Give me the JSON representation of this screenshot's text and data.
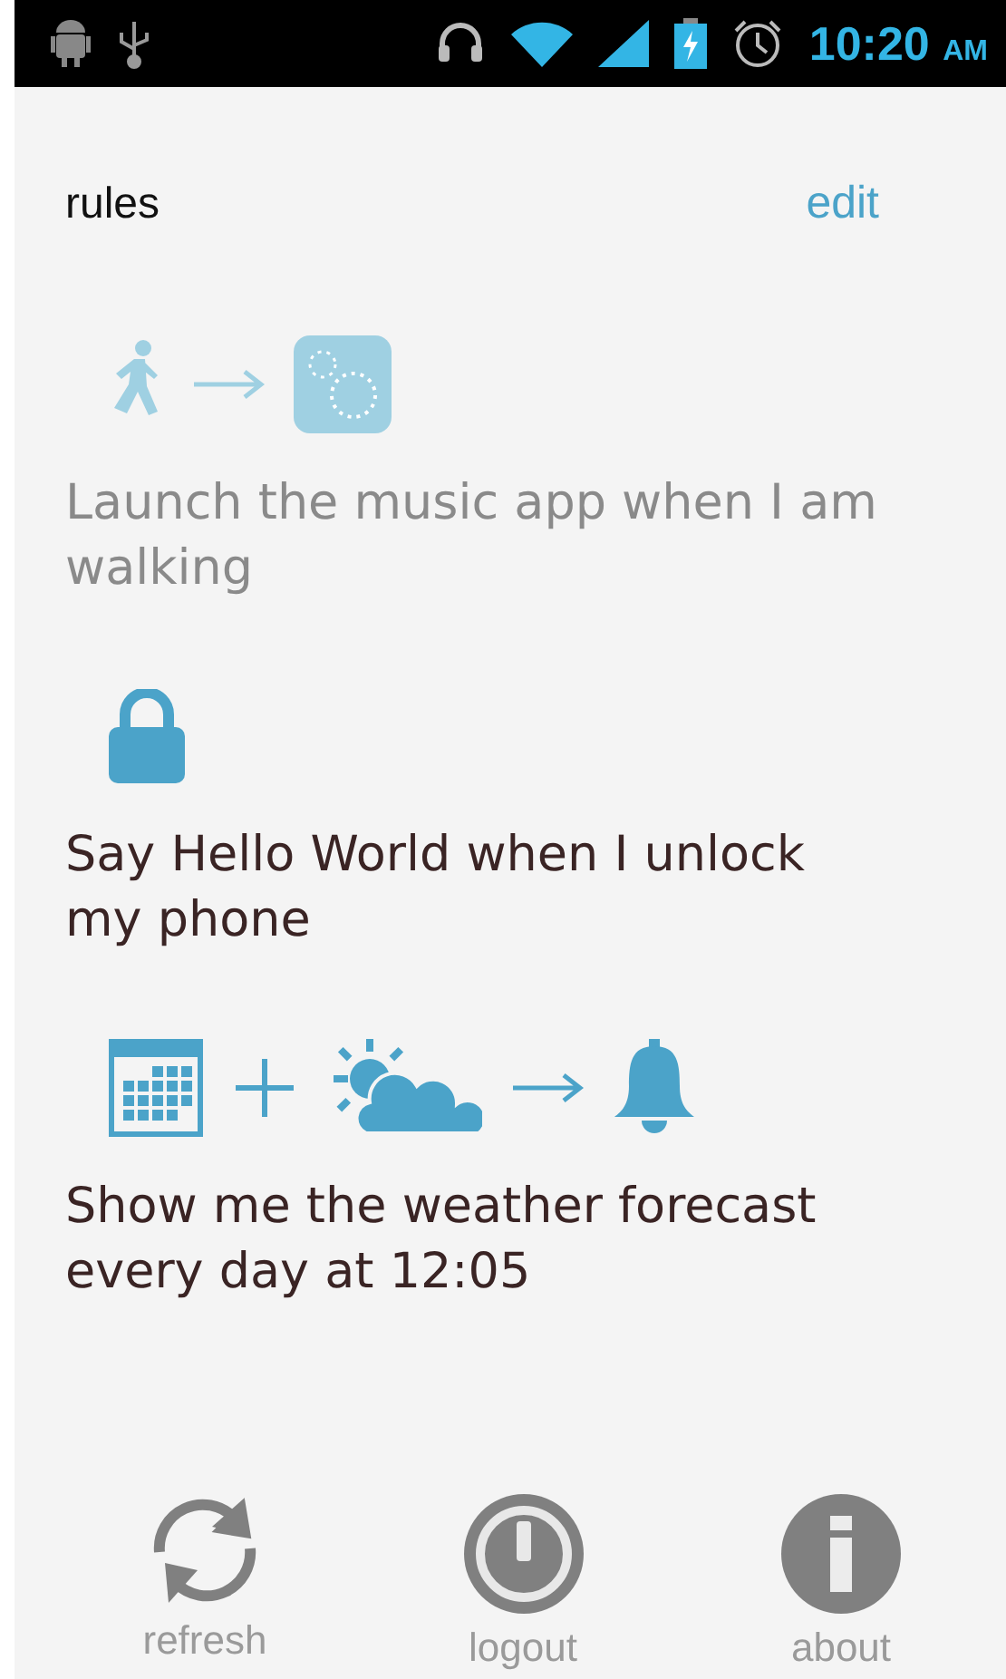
{
  "status_bar": {
    "time": "10:20",
    "meridiem": "AM"
  },
  "header": {
    "title": "rules",
    "action": "edit"
  },
  "rules": [
    {
      "enabled": false,
      "icons": [
        {
          "kind": "walk"
        },
        {
          "kind": "arrow"
        },
        {
          "kind": "app"
        }
      ],
      "text": "Launch the music app when I am walking"
    },
    {
      "enabled": true,
      "icons": [
        {
          "kind": "lock"
        }
      ],
      "text": "Say Hello World when I unlock my phone"
    },
    {
      "enabled": true,
      "icons": [
        {
          "kind": "calendar"
        },
        {
          "kind": "plus"
        },
        {
          "kind": "weather"
        },
        {
          "kind": "arrow"
        },
        {
          "kind": "bell"
        }
      ],
      "text": "Show me the weather forecast every day at 12:05"
    }
  ],
  "bottom_bar": [
    {
      "kind": "refresh",
      "label": "refresh"
    },
    {
      "kind": "logout",
      "label": "logout"
    },
    {
      "kind": "about",
      "label": "about"
    }
  ]
}
